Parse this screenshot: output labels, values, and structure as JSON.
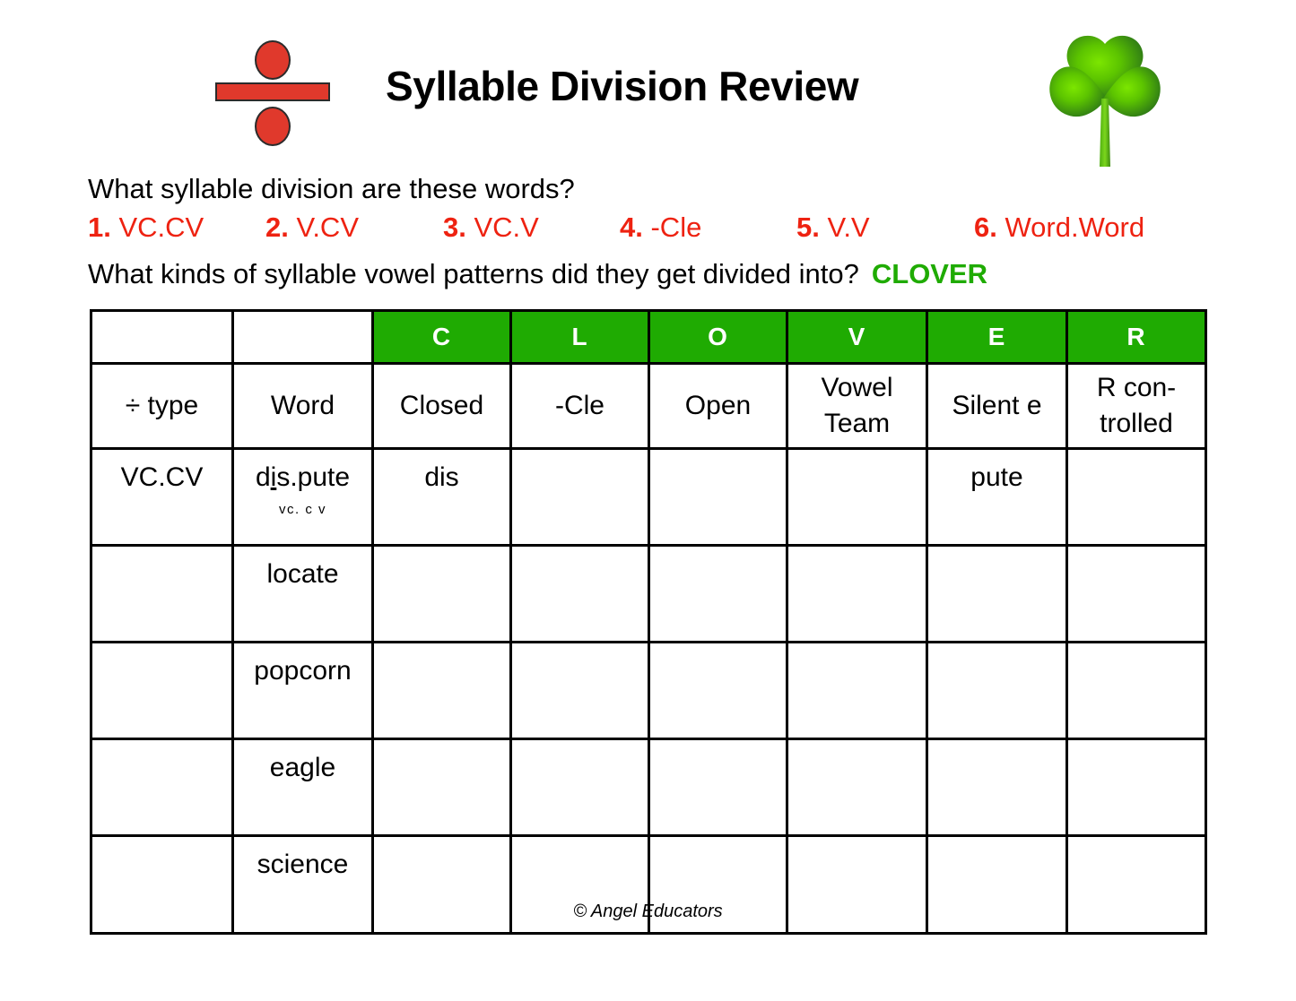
{
  "header": {
    "title": "Syllable Division Review",
    "divide_icon_name": "division-sign-icon",
    "clover_icon_name": "shamrock-icon"
  },
  "prompts": {
    "question1": "What syllable division are these words?",
    "patterns": [
      {
        "num": "1.",
        "value": "VC.CV"
      },
      {
        "num": "2.",
        "value": "V.CV"
      },
      {
        "num": "3.",
        "value": "VC.V"
      },
      {
        "num": "4.",
        "value": "-Cle"
      },
      {
        "num": "5.",
        "value": "V.V"
      },
      {
        "num": "6.",
        "value": "Word.Word"
      }
    ],
    "question2": "What kinds of syllable vowel patterns did they get divided into?",
    "answer_keyword": "CLOVER"
  },
  "table": {
    "clover_header": [
      "",
      "",
      "C",
      "L",
      "O",
      "V",
      "E",
      "R"
    ],
    "column_labels": [
      "÷ type",
      "Word",
      "Closed",
      "-Cle",
      "Open",
      "Vowel Team",
      "Silent e",
      "R con-trolled"
    ],
    "rows": [
      {
        "type": "VC.CV",
        "word_before": "d",
        "word_underlined": "i",
        "word_after": "s.pute",
        "word_plain": "dis.pute",
        "annotation": "vc. c  v",
        "closed": "dis",
        "cle": "",
        "open": "",
        "vowel_team": "",
        "silent_e": "pute",
        "r_controlled": ""
      },
      {
        "type": "",
        "word_plain": "locate",
        "annotation": "",
        "closed": "",
        "cle": "",
        "open": "",
        "vowel_team": "",
        "silent_e": "",
        "r_controlled": ""
      },
      {
        "type": "",
        "word_plain": "popcorn",
        "annotation": "",
        "closed": "",
        "cle": "",
        "open": "",
        "vowel_team": "",
        "silent_e": "",
        "r_controlled": ""
      },
      {
        "type": "",
        "word_plain": "eagle",
        "annotation": "",
        "closed": "",
        "cle": "",
        "open": "",
        "vowel_team": "",
        "silent_e": "",
        "r_controlled": ""
      },
      {
        "type": "",
        "word_plain": "science",
        "annotation": "",
        "closed": "",
        "cle": "",
        "open": "",
        "vowel_team": "",
        "silent_e": "",
        "r_controlled": ""
      }
    ]
  },
  "footer": {
    "copyright": "© Angel Educators"
  },
  "colors": {
    "green": "#1fab02",
    "red": "#ee2211",
    "icon_red": "#e0392c",
    "ink": "#000000"
  }
}
